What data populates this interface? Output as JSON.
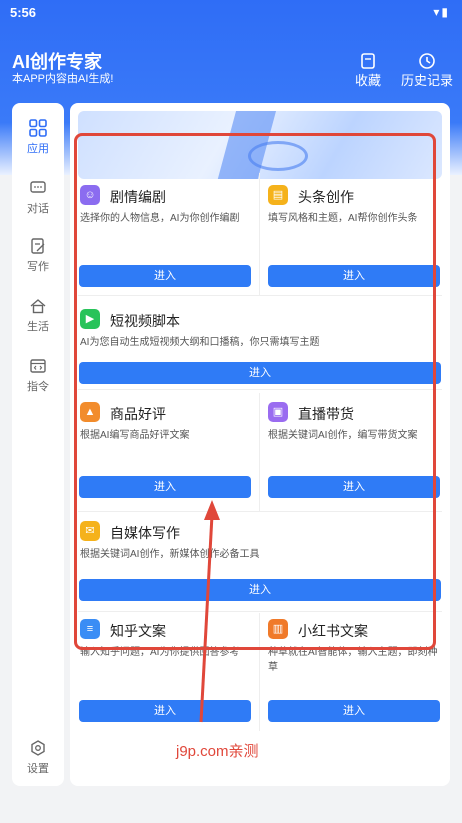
{
  "status": {
    "time": "5:56",
    "icons": "▾▮"
  },
  "app": {
    "title": "AI创作专家",
    "subtitle": "本APP内容由AI生成!"
  },
  "header_actions": {
    "favorites": "收藏",
    "history": "历史记录"
  },
  "sidebar": {
    "items": [
      {
        "label": "应用",
        "icon": "grid-icon",
        "active": true
      },
      {
        "label": "对话",
        "icon": "chat-icon",
        "active": false
      },
      {
        "label": "写作",
        "icon": "edit-icon",
        "active": false
      },
      {
        "label": "生活",
        "icon": "home-icon",
        "active": false
      },
      {
        "label": "指令",
        "icon": "code-icon",
        "active": false
      }
    ],
    "settings": "设置"
  },
  "cards": [
    {
      "title": "剧情编剧",
      "desc": "选择你的人物信息，AI为你创作编剧",
      "button": "进入",
      "icon_color": "#8b6cf0"
    },
    {
      "title": "头条创作",
      "desc": "填写风格和主题，AI帮你创作头条",
      "button": "进入",
      "icon_color": "#f5b21b"
    },
    {
      "title": "短视频脚本",
      "desc": "AI为您自动生成短视频大纲和口播稿，你只需填写主题",
      "button": "进入",
      "icon_color": "#28c35a"
    },
    {
      "title": "商品好评",
      "desc": "根据AI编写商品好评文案",
      "button": "进入",
      "icon_color": "#f28c2c"
    },
    {
      "title": "直播带货",
      "desc": "根据关键词AI创作，编写带货文案",
      "button": "进入",
      "icon_color": "#9a6cf0"
    },
    {
      "title": "自媒体写作",
      "desc": "根据关键词AI创作，新媒体创作必备工具",
      "button": "进入",
      "icon_color": "#f5b21b"
    },
    {
      "title": "知乎文案",
      "desc": "输入知乎问题，AI为你提供回答参考",
      "button": "进入",
      "icon_color": "#3a8df5"
    },
    {
      "title": "小红书文案",
      "desc": "种草就在AI智能体，输入主题，即刻种草",
      "button": "进入",
      "icon_color": "#f07a2a"
    }
  ],
  "watermark": "j9p.com亲测",
  "colors": {
    "primary": "#2f6df6",
    "annotation": "#e0473a"
  }
}
